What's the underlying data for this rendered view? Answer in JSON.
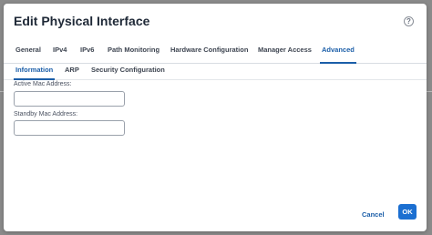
{
  "dialog": {
    "title": "Edit Physical Interface",
    "help_icon": "help-circle-icon",
    "help_glyph": "?"
  },
  "tabs": [
    {
      "label": "General",
      "active": false
    },
    {
      "label": "IPv4",
      "active": false
    },
    {
      "label": "IPv6",
      "active": false
    },
    {
      "label": "Path Monitoring",
      "active": false
    },
    {
      "label": "Hardware Configuration",
      "active": false
    },
    {
      "label": "Manager Access",
      "active": false
    },
    {
      "label": "Advanced",
      "active": true
    }
  ],
  "subtabs": [
    {
      "label": "Information",
      "active": true
    },
    {
      "label": "ARP",
      "active": false
    },
    {
      "label": "Security Configuration",
      "active": false
    }
  ],
  "form": {
    "active_mac_label": "Active Mac Address:",
    "active_mac_value": "",
    "standby_mac_label": "Standby Mac Address:",
    "standby_mac_value": ""
  },
  "footer": {
    "cancel_label": "Cancel",
    "ok_label": "OK"
  },
  "colors": {
    "accent": "#1b5ea8",
    "primary_button": "#1b6fd1",
    "overlay": "#8a8a8a"
  }
}
